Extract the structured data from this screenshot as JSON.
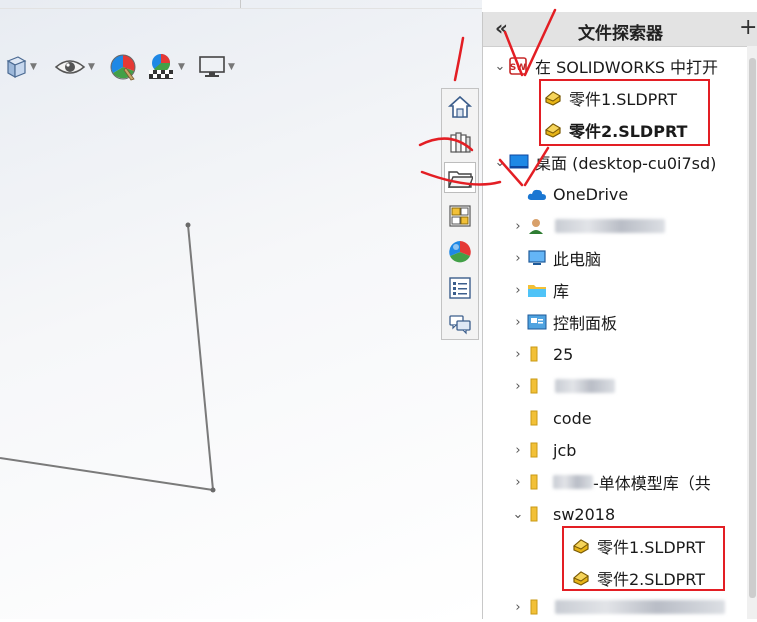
{
  "explorer": {
    "title": "文件探索器",
    "collapse_label": "«",
    "add_label": "+",
    "rows": [
      {
        "label": "在 SOLIDWORKS 中打开",
        "icon": "solidworks-icon",
        "expanded": true
      },
      {
        "label": "零件1.SLDPRT",
        "icon": "part-icon"
      },
      {
        "label": "零件2.SLDPRT",
        "icon": "part-icon",
        "bold": true
      },
      {
        "label": "桌面 (desktop-cu0i7sd)",
        "icon": "desktop-icon",
        "expanded": true
      },
      {
        "label": "OneDrive",
        "icon": "cloud-icon"
      },
      {
        "label": "",
        "icon": "user-icon",
        "redacted": true
      },
      {
        "label": "此电脑",
        "icon": "computer-icon"
      },
      {
        "label": "库",
        "icon": "library-folder-icon"
      },
      {
        "label": "控制面板",
        "icon": "control-panel-icon"
      },
      {
        "label": "25",
        "icon": "folder-icon"
      },
      {
        "label": "",
        "icon": "folder-icon",
        "redacted": true
      },
      {
        "label": "code",
        "icon": "folder-icon"
      },
      {
        "label": "jcb",
        "icon": "folder-icon"
      },
      {
        "label": "-单体模型库（共",
        "icon": "folder-icon",
        "partially_redacted": true
      },
      {
        "label": "sw2018",
        "icon": "folder-icon",
        "expanded": true
      },
      {
        "label": "零件1.SLDPRT",
        "icon": "part-icon"
      },
      {
        "label": "零件2.SLDPRT",
        "icon": "part-icon"
      },
      {
        "label": "",
        "icon": "folder-icon",
        "redacted": true
      }
    ]
  },
  "toolbar": {
    "icons": [
      "view-orientation-icon",
      "hide-show-icon",
      "appearance-icon",
      "scene-icon",
      "display-settings-icon"
    ]
  },
  "taskpane_tabs": [
    "home-icon",
    "design-library-icon",
    "file-explorer-icon",
    "view-palette-icon",
    "appearances-scenes-icon",
    "custom-properties-icon",
    "forum-icon"
  ],
  "colors": {
    "annotation_red": "#e31e24",
    "folder_yellow": "#f2c037",
    "part_yellow": "#e7b416"
  }
}
